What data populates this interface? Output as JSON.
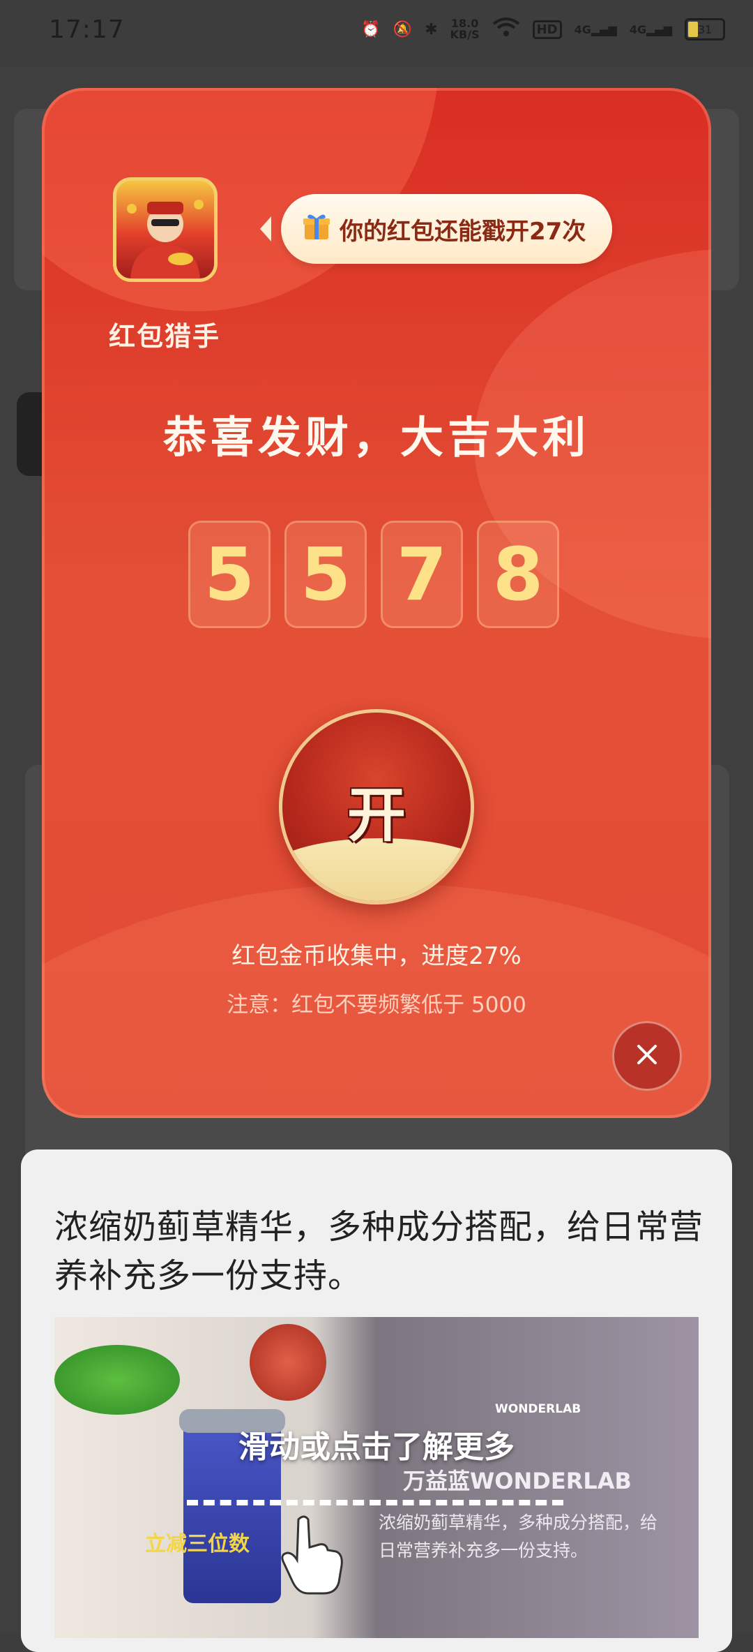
{
  "status_bar": {
    "time": "17:17",
    "net_speed_value": "18.0",
    "net_speed_unit": "KB/S",
    "hd_badge": "HD",
    "signal_1": "4G",
    "signal_2": "4G",
    "battery": "31"
  },
  "popup": {
    "app_name": "红包猎手",
    "bubble_text": "你的红包还能戳开27次",
    "headline": "恭喜发财，大吉大利",
    "digits": [
      "5",
      "5",
      "7",
      "8"
    ],
    "open_button": "开",
    "progress_text": "红包金币收集中，进度27%",
    "note_text": "注意：红包不要频繁低于 5000"
  },
  "ad": {
    "description": "浓缩奶蓟草精华，多种成分搭配，给日常营养补充多一份支持。",
    "image_brand_mark": "WONDERLAB",
    "image_brand": "万益蓝WONDERLAB",
    "image_subtitle": "浓缩奶蓟草精华，多种成分搭配，给日常营养补充多一份支持。",
    "image_promo": "立减三位数",
    "swipe_hint": "滑动或点击了解更多"
  },
  "colors": {
    "popup_red": "#e24a35",
    "digit_gold": "#fde28a",
    "bubble_text": "#8a2a14"
  }
}
